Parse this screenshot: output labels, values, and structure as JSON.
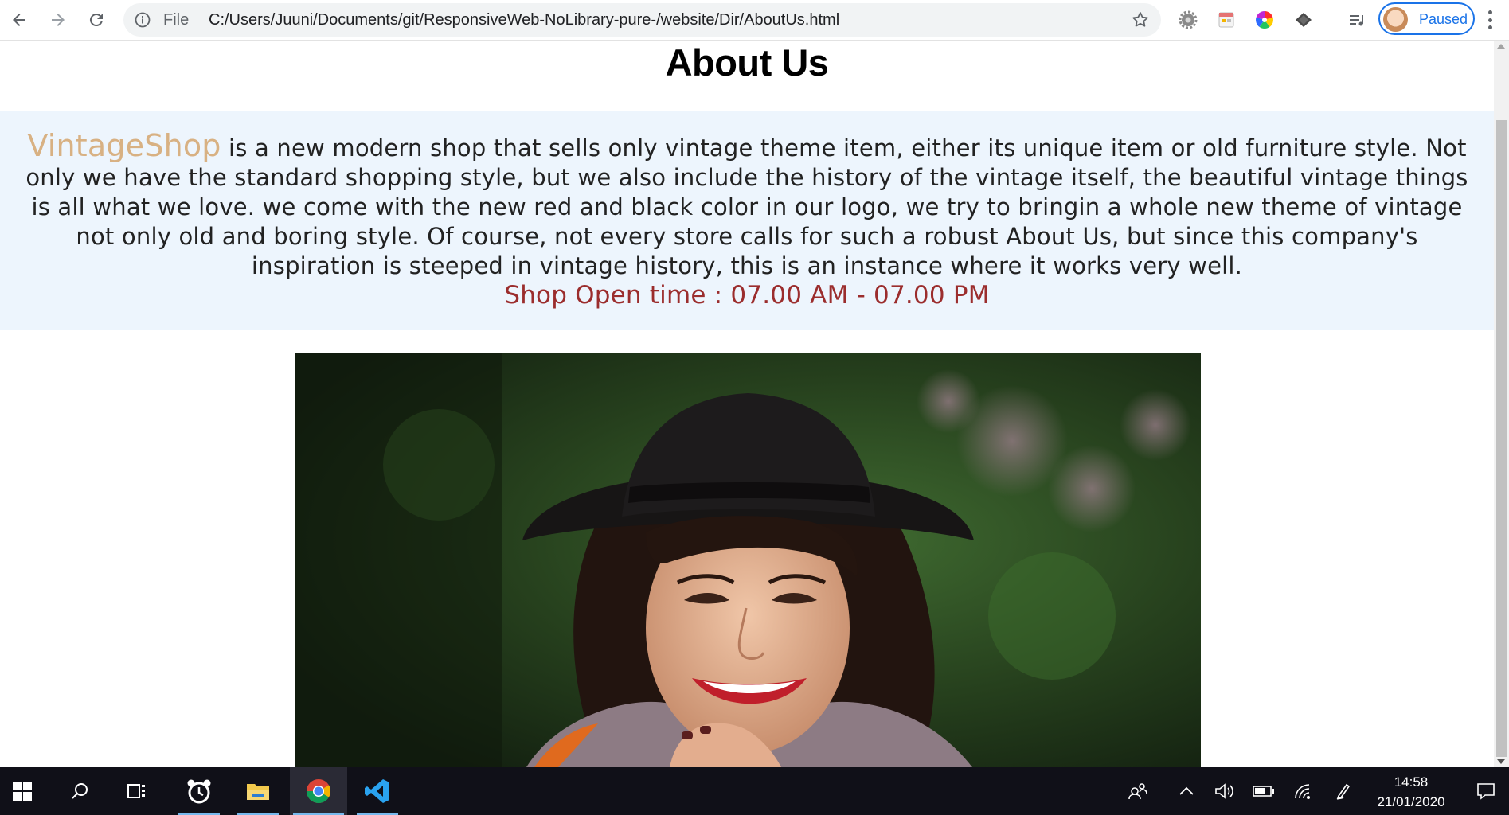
{
  "browser": {
    "omnibox": {
      "scheme_label": "File",
      "url": "C:/Users/Juuni/Documents/git/ResponsiveWeb-NoLibrary-pure-/website/Dir/AboutUs.html"
    },
    "profile": {
      "label": "Paused"
    },
    "icons": {
      "back": "back-arrow-icon",
      "forward": "forward-arrow-icon",
      "reload": "reload-icon",
      "info": "info-icon",
      "star": "bookmark-star-icon",
      "extensions": [
        "settings-gear-extension-icon",
        "calendar-extension-icon",
        "color-wheel-extension-icon",
        "layers-extension-icon",
        "media-queue-icon"
      ],
      "menu": "kebab-menu-icon"
    }
  },
  "page": {
    "title": "About Us",
    "about": {
      "brand": "VintageShop",
      "text": " is a new modern shop that sells only vintage theme item, either its unique item or old furniture style. Not only we have the standard shopping style, but we also include the history of the vintage itself, the beautiful vintage things is all what we love. we come with the new red and black color in our logo, we try to bringin a whole new theme of vintage not only old and boring style. Of course, not every store calls for such a robust About Us, but since this company's inspiration is steeped in vintage history, this is an instance where it works very well.",
      "open_time": "Shop Open time : 07.00 AM - 07.00 PM"
    },
    "colors": {
      "band_background": "#edf5fd",
      "brand_color": "#d8b183",
      "open_time_color": "#9b2d2d"
    }
  },
  "taskbar": {
    "apps": [
      "windows-start-icon",
      "search-icon",
      "task-view-icon",
      "alarm-clock-app-icon",
      "file-explorer-icon",
      "chrome-icon",
      "vscode-icon"
    ],
    "active_app": "chrome-icon",
    "tray_icons": [
      "people-icon",
      "show-hidden-icons-chevron-icon",
      "volume-icon",
      "battery-icon",
      "wifi-icon",
      "pen-icon",
      "notification-icon"
    ],
    "time": "14:58",
    "date": "21/01/2020"
  }
}
